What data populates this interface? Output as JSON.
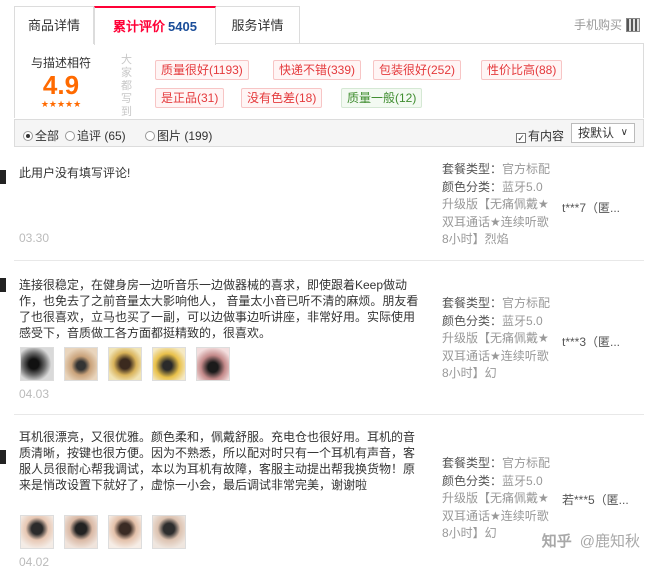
{
  "tabs": {
    "detail": "商品详情",
    "reviews": "累计评价",
    "reviews_count": "5405",
    "service": "服务详情",
    "mobile_buy": "手机购买"
  },
  "rating": {
    "label": "与描述相符",
    "score": "4.9",
    "stars": "★★★★★"
  },
  "impressions": {
    "label": "大家都写到",
    "tags": [
      {
        "text": "质量很好(1193)",
        "tone": "positive"
      },
      {
        "text": "快递不错(339)",
        "tone": "positive"
      },
      {
        "text": "包装很好(252)",
        "tone": "positive"
      },
      {
        "text": "性价比高(88)",
        "tone": "positive"
      },
      {
        "text": "是正品(31)",
        "tone": "positive"
      },
      {
        "text": "没有色差(18)",
        "tone": "positive"
      },
      {
        "text": "质量一般(12)",
        "tone": "neutral"
      }
    ]
  },
  "filter": {
    "all": "全部",
    "append": "追评 (65)",
    "images": "图片 (199)",
    "has_content": "有内容",
    "sort": "按默认"
  },
  "reviews": [
    {
      "text": "此用户没有填写评论!",
      "date": "03.30",
      "photos": 0,
      "sku_pkg_label": "套餐类型：",
      "sku_pkg_value": "官方标配",
      "sku_color_label": "颜色分类：",
      "sku_color_value": "蓝牙5.0",
      "sku_extra": "升级版【无痛佩戴★双耳通话★连续听歌8小时】烈焰",
      "user": "t***7（匿..."
    },
    {
      "text": "连接很稳定，在健身房一边听音乐一边做器械的喜求，即使跟着Keep做动作，也免去了之前音量太大影响他人， 音量太小音已听不清的麻烦。朋友看了也很喜欢，立马也买了一副，可以边做事边听讲座，非常好用。实际使用感受下，音质做工各方面都挺精致的，很喜欢。",
      "date": "04.03",
      "photos": 5,
      "sku_pkg_label": "套餐类型：",
      "sku_pkg_value": "官方标配",
      "sku_color_label": "颜色分类：",
      "sku_color_value": "蓝牙5.0",
      "sku_extra": "升级版【无痛佩戴★双耳通话★连续听歌8小时】幻",
      "user": "t***3（匿..."
    },
    {
      "text": "耳机很漂亮，又很优雅。颜色柔和，佩戴舒服。充电仓也很好用。耳机的音质清晰，按键也很方便。因为不熟悉，所以配对时只有一个耳机有声音，客服人员很耐心帮我调试，本以为耳机有故障，客服主动提出帮我换货物！原来是悄改设置下就好了，虚惊一小会，最后调试非常完美，谢谢啦",
      "date": "04.02",
      "photos": 4,
      "sku_pkg_label": "套餐类型：",
      "sku_pkg_value": "官方标配",
      "sku_color_label": "颜色分类：",
      "sku_color_value": "蓝牙5.0",
      "sku_extra": "升级版【无痛佩戴★双耳通话★连续听歌8小时】幻",
      "user": "若***5（匿..."
    }
  ],
  "watermark": {
    "logo": "知乎",
    "author": "@鹿知秋"
  },
  "colors": {
    "accent": "#ff0036",
    "score": "#ff6a00",
    "tag_text": "#e4393c"
  }
}
